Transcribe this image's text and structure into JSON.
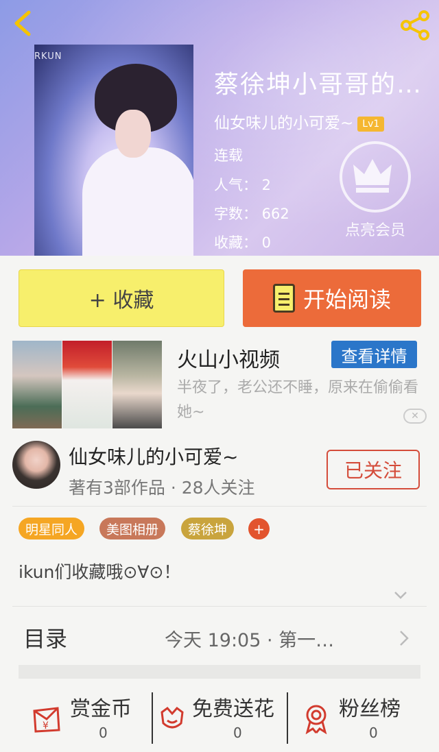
{
  "header": {
    "back_icon": "chevron-left-icon",
    "share_icon": "share-icon"
  },
  "cover": {
    "brand_text": "RKUN"
  },
  "book": {
    "title": "蔡徐坤小哥哥的…",
    "author": "仙女味儿的小可爱~",
    "level": "Lv1",
    "status": "连载",
    "popularity": "人气： 2",
    "word_count": "字数： 662",
    "favorites": "收藏： 0"
  },
  "vip": {
    "label": "点亮会员",
    "icon": "crown-icon"
  },
  "actions": {
    "favorite_label": "+ 收藏",
    "read_label": "开始阅读"
  },
  "ad": {
    "title": "火山小视频",
    "button": "查看详情",
    "description": "半夜了，老公还不睡，原来在偷偷看她~",
    "close": "✕"
  },
  "author_card": {
    "name": "仙女味儿的小可爱~",
    "meta": "著有3部作品 · 28人关注",
    "follow_label": "已关注"
  },
  "tags": [
    {
      "label": "明星同人",
      "color": "#f5a623"
    },
    {
      "label": "美图相册",
      "color": "#c8785a"
    },
    {
      "label": "蔡徐坤",
      "color": "#c9a43d"
    }
  ],
  "tag_add": "+",
  "description": "ikun们收藏哦⊙∀⊙！",
  "toc": {
    "label": "目录",
    "latest": "今天 19:05 · 第一…"
  },
  "bottom": [
    {
      "label": "赏金币",
      "count": "0",
      "icon": "red-envelope-icon"
    },
    {
      "label": "免费送花",
      "count": "0",
      "icon": "flower-icon"
    },
    {
      "label": "粉丝榜",
      "count": "0",
      "icon": "medal-icon"
    }
  ],
  "colors": {
    "accent": "#ec6b3a",
    "favorite_bg": "#f7ef6c",
    "follow": "#d44c3a",
    "ad_button": "#2b76c9"
  }
}
